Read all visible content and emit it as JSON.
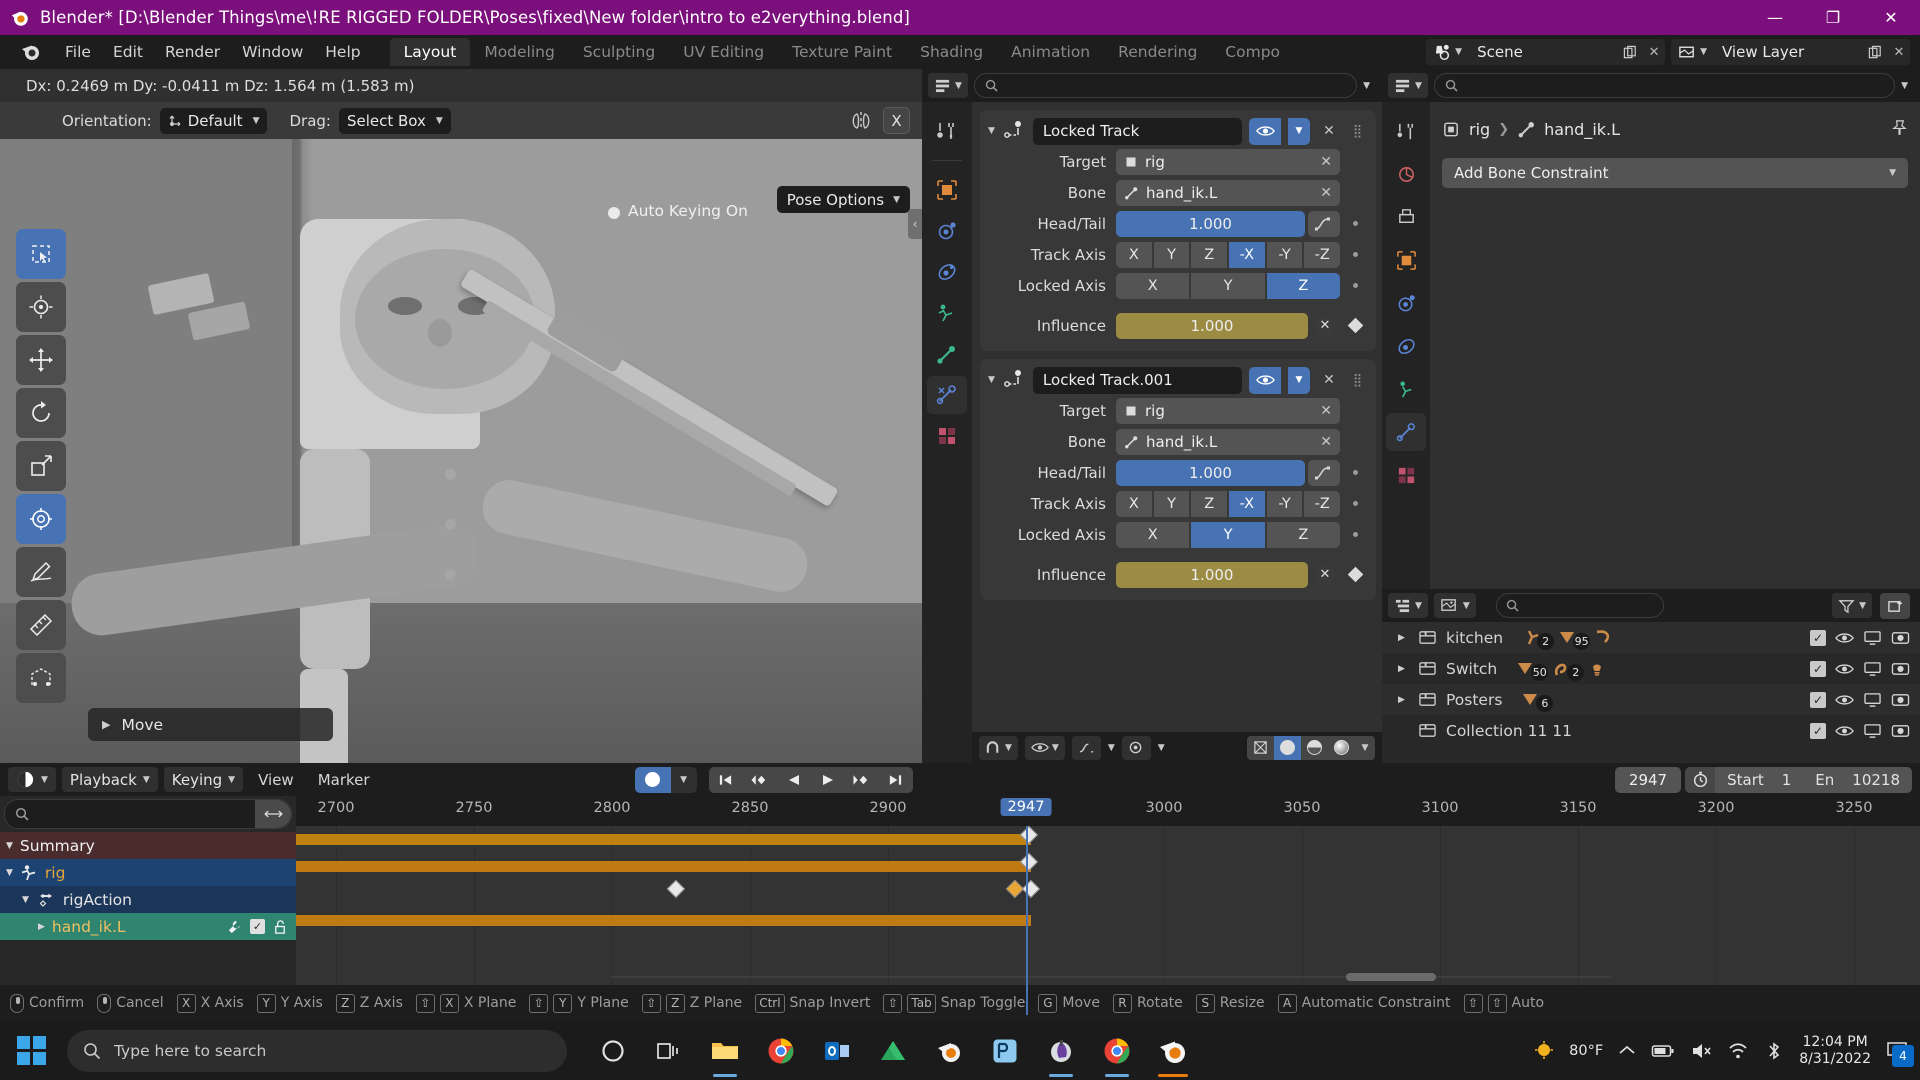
{
  "titlebar": {
    "text": "Blender* [D:\\Blender Things\\me\\!RE RIGGED FOLDER\\Poses\\fixed\\New folder\\intro to e2verything.blend]",
    "minimize": "—",
    "maximize": "❐",
    "close": "✕"
  },
  "menubar": {
    "items": [
      "File",
      "Edit",
      "Render",
      "Window",
      "Help"
    ],
    "tabs": [
      {
        "label": "Layout",
        "active": true
      },
      {
        "label": "Modeling",
        "active": false
      },
      {
        "label": "Sculpting",
        "active": false
      },
      {
        "label": "UV Editing",
        "active": false
      },
      {
        "label": "Texture Paint",
        "active": false
      },
      {
        "label": "Shading",
        "active": false
      },
      {
        "label": "Animation",
        "active": false
      },
      {
        "label": "Rendering",
        "active": false
      },
      {
        "label": "Compo",
        "active": false
      }
    ],
    "scene_name": "Scene",
    "viewlayer_name": "View Layer"
  },
  "viewport": {
    "delta_text": "Dx: 0.2469 m   Dy: -0.0411 m   Dz: 1.564 m (1.583 m)",
    "orientation_label": "Orientation:",
    "orientation_value": "Default",
    "drag_label": "Drag:",
    "drag_value": "Select Box",
    "x_button": "X",
    "pose_options": "Pose Options",
    "autokeying": "Auto Keying On",
    "operator_panel": "Move",
    "tools": [
      "tweak-tool",
      "cursor-tool",
      "move-tool",
      "rotate-tool",
      "scale-tool",
      "transform-tool",
      "annotate-tool",
      "measure-tool",
      "add-cube-tool"
    ]
  },
  "properties": {
    "search_placeholder": "",
    "tabs": [
      "tool-tab",
      "render-tab",
      "output-tab",
      "view-layer-tab",
      "scene-tab",
      "world-tab",
      "object-tab",
      "modifiers-tab",
      "particles-tab",
      "physics-tab",
      "constraints-tab",
      "data-tab",
      "material-tab"
    ],
    "constraints": [
      {
        "name": "Locked Track",
        "target_label": "Target",
        "target_value": "rig",
        "bone_label": "Bone",
        "bone_value": "hand_ik.L",
        "headtail_label": "Head/Tail",
        "headtail_value": "1.000",
        "trackaxis_label": "Track Axis",
        "trackaxis_options": [
          "X",
          "Y",
          "Z",
          "-X",
          "-Y",
          "-Z"
        ],
        "trackaxis_selected": "-X",
        "lockedaxis_label": "Locked Axis",
        "lockedaxis_options": [
          "X",
          "Y",
          "Z"
        ],
        "lockedaxis_selected": "Z",
        "influence_label": "Influence",
        "influence_value": "1.000"
      },
      {
        "name": "Locked Track.001",
        "target_label": "Target",
        "target_value": "rig",
        "bone_label": "Bone",
        "bone_value": "hand_ik.L",
        "headtail_label": "Head/Tail",
        "headtail_value": "1.000",
        "trackaxis_label": "Track Axis",
        "trackaxis_options": [
          "X",
          "Y",
          "Z",
          "-X",
          "-Y",
          "-Z"
        ],
        "trackaxis_selected": "-X",
        "lockedaxis_label": "Locked Axis",
        "lockedaxis_options": [
          "X",
          "Y",
          "Z"
        ],
        "lockedaxis_selected": "Y",
        "influence_label": "Influence",
        "influence_value": "1.000"
      }
    ]
  },
  "bone_constraint_panel": {
    "breadcrumb_object": "rig",
    "breadcrumb_bone": "hand_ik.L",
    "add_constraint_label": "Add Bone Constraint"
  },
  "outliner": {
    "search_placeholder": "",
    "rows": [
      {
        "name": "kitchen",
        "expandable": true,
        "badges": [
          {
            "icon": "armature-icon",
            "count": "2"
          },
          {
            "icon": "mesh-icon",
            "count": "95"
          },
          {
            "icon": "curve-icon",
            "count": ""
          }
        ]
      },
      {
        "name": "Switch",
        "expandable": true,
        "badges": [
          {
            "icon": "mesh-icon",
            "count": "50"
          },
          {
            "icon": "curve-icon",
            "count": "2"
          },
          {
            "icon": "light-icon",
            "count": ""
          }
        ]
      },
      {
        "name": "Posters",
        "expandable": true,
        "badges": [
          {
            "icon": "mesh-icon",
            "count": "6"
          }
        ]
      },
      {
        "name": "Collection 11 11",
        "expandable": false,
        "badges": []
      }
    ]
  },
  "dopesheet": {
    "menus": [
      "View",
      "Marker"
    ],
    "playback_label": "Playback",
    "keying_label": "Keying",
    "search_placeholder": "",
    "channels": [
      {
        "label": "Summary",
        "type": "summary",
        "expanded": true
      },
      {
        "label": "rig",
        "type": "object",
        "expanded": true
      },
      {
        "label": "rigAction",
        "type": "action",
        "expanded": true
      },
      {
        "label": "hand_ik.L",
        "type": "bone",
        "expanded": false
      }
    ],
    "ruler_ticks": [
      "2700",
      "2750",
      "2800",
      "2850",
      "2900",
      "2947",
      "3000",
      "3050",
      "3100",
      "3150",
      "3200",
      "3250"
    ],
    "current_frame": "2947",
    "start_label": "Start",
    "start_value": "1",
    "end_label": "En",
    "end_value": "10218",
    "frame_value": "2947"
  },
  "statusbar": {
    "items": [
      {
        "keys": [
          "mouse"
        ],
        "label": "Confirm"
      },
      {
        "keys": [
          "mouse"
        ],
        "label": "Cancel"
      },
      {
        "keys": [
          "X"
        ],
        "label": "X Axis"
      },
      {
        "keys": [
          "Y"
        ],
        "label": "Y Axis"
      },
      {
        "keys": [
          "Z"
        ],
        "label": "Z Axis"
      },
      {
        "keys": [
          "⇧",
          "X"
        ],
        "label": "X Plane"
      },
      {
        "keys": [
          "⇧",
          "Y"
        ],
        "label": "Y Plane"
      },
      {
        "keys": [
          "⇧",
          "Z"
        ],
        "label": "Z Plane"
      },
      {
        "keys": [
          "Ctrl"
        ],
        "label": "Snap Invert"
      },
      {
        "keys": [
          "⇧",
          "Tab"
        ],
        "label": "Snap Toggle"
      },
      {
        "keys": [
          "G"
        ],
        "label": "Move"
      },
      {
        "keys": [
          "R"
        ],
        "label": "Rotate"
      },
      {
        "keys": [
          "S"
        ],
        "label": "Resize"
      },
      {
        "keys": [
          "A"
        ],
        "label": "Automatic Constraint"
      },
      {
        "keys": [
          "⇧",
          "⇧"
        ],
        "label": "Auto"
      }
    ]
  },
  "taskbar": {
    "search_placeholder": "Type here to search",
    "weather": "80°F",
    "time": "12:04 PM",
    "date": "8/31/2022",
    "notification_count": "4"
  },
  "colors": {
    "accent_blue": "#4772b3",
    "title_purple": "#7b0f7b",
    "keyframe_orange": "#c07a14",
    "influence_olive": "#9b8b43"
  }
}
